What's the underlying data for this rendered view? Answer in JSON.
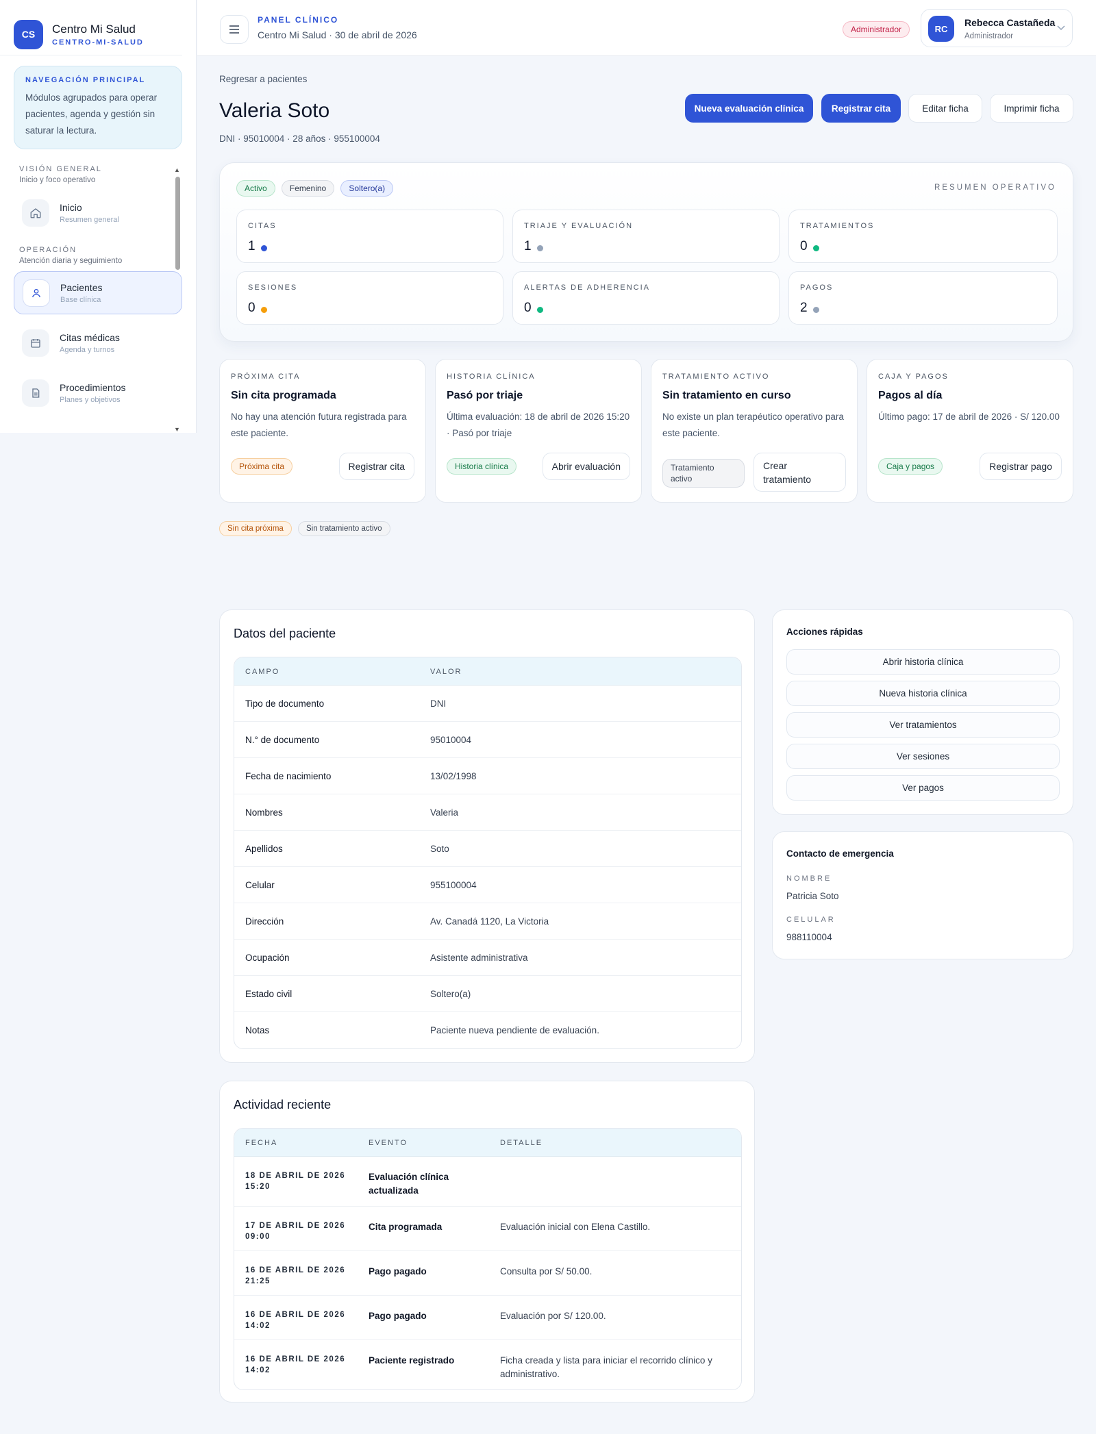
{
  "brand": {
    "logo": "CS",
    "name": "Centro Mi Salud",
    "slug": "CENTRO-MI-SALUD"
  },
  "nav_box": {
    "title": "NAVEGACIÓN PRINCIPAL",
    "text": "Módulos agrupados para operar pacientes, agenda y gestión sin saturar la lectura."
  },
  "sidebar": {
    "sections": [
      {
        "title": "VISIÓN GENERAL",
        "subtitle": "Inicio y foco operativo"
      },
      {
        "title": "OPERACIÓN",
        "subtitle": "Atención diaria y seguimiento"
      }
    ],
    "items": [
      {
        "label": "Inicio",
        "sub": "Resumen general",
        "icon": "home-icon"
      },
      {
        "label": "Pacientes",
        "sub": "Base clínica",
        "icon": "user-icon",
        "active": true
      },
      {
        "label": "Citas médicas",
        "sub": "Agenda y turnos",
        "icon": "calendar-icon"
      },
      {
        "label": "Procedimientos",
        "sub": "Planes y objetivos",
        "icon": "document-icon"
      }
    ]
  },
  "topbar": {
    "title": "PANEL CLÍNICO",
    "subtitle": "Centro Mi Salud · 30 de abril de 2026",
    "badge": "Administrador",
    "user": {
      "initials": "RC",
      "name": "Rebecca Castañeda",
      "role": "Administrador"
    }
  },
  "patient": {
    "back": "Regresar a pacientes",
    "name": "Valeria Soto",
    "meta": "DNI · 95010004 · 28 años · 955100004",
    "actions": [
      "Nueva evaluación clínica",
      "Registrar cita",
      "Editar ficha",
      "Imprimir ficha"
    ]
  },
  "summary": {
    "tags": [
      "Activo",
      "Femenino",
      "Soltero(a)"
    ],
    "heading": "RESUMEN OPERATIVO",
    "stats": [
      {
        "label": "CITAS",
        "value": "1",
        "color": "#2f54d6"
      },
      {
        "label": "TRIAJE Y EVALUACIÓN",
        "value": "1",
        "color": "#94a3b8"
      },
      {
        "label": "TRATAMIENTOS",
        "value": "0",
        "color": "#10b981"
      },
      {
        "label": "SESIONES",
        "value": "0",
        "color": "#f59e0b"
      },
      {
        "label": "ALERTAS DE ADHERENCIA",
        "value": "0",
        "color": "#10b981"
      },
      {
        "label": "PAGOS",
        "value": "2",
        "color": "#94a3b8"
      }
    ]
  },
  "cards": [
    {
      "label": "PRÓXIMA CITA",
      "title": "Sin cita programada",
      "text": "No hay una atención futura registrada para este paciente.",
      "tag": "Próxima cita",
      "button": "Registrar cita"
    },
    {
      "label": "HISTORIA CLÍNICA",
      "title": "Pasó por triaje",
      "text": "Última evaluación: 18 de abril de 2026 15:20 · Pasó por triaje",
      "tag": "Historia clínica",
      "button": "Abrir evaluación"
    },
    {
      "label": "TRATAMIENTO ACTIVO",
      "title": "Sin tratamiento en curso",
      "text": "No existe un plan terapéutico operativo para este paciente.",
      "tag": "Tratamiento activo",
      "button": "Crear tratamiento"
    },
    {
      "label": "CAJA Y PAGOS",
      "title": "Pagos al día",
      "text": "Último pago: 17 de abril de 2026 · S/ 120.00",
      "tag": "Caja y pagos",
      "button": "Registrar pago"
    }
  ],
  "status_tags": [
    "Sin cita próxima",
    "Sin tratamiento activo"
  ],
  "datos": {
    "title": "Datos del paciente",
    "headers": [
      "CAMPO",
      "VALOR"
    ],
    "rows": [
      [
        "Tipo de documento",
        "DNI"
      ],
      [
        "N.° de documento",
        "95010004"
      ],
      [
        "Fecha de nacimiento",
        "13/02/1998"
      ],
      [
        "Nombres",
        "Valeria"
      ],
      [
        "Apellidos",
        "Soto"
      ],
      [
        "Celular",
        "955100004"
      ],
      [
        "Dirección",
        "Av. Canadá 1120, La Victoria"
      ],
      [
        "Ocupación",
        "Asistente administrativa"
      ],
      [
        "Estado civil",
        "Soltero(a)"
      ],
      [
        "Notas",
        "Paciente nueva pendiente de evaluación."
      ]
    ]
  },
  "actividad": {
    "title": "Actividad reciente",
    "headers": [
      "FECHA",
      "EVENTO",
      "DETALLE"
    ],
    "rows": [
      {
        "fecha": "18 DE ABRIL DE 2026 15:20",
        "evento": "Evaluación clínica actualizada",
        "detalle": ""
      },
      {
        "fecha": "17 DE ABRIL DE 2026 09:00",
        "evento": "Cita programada",
        "detalle": "Evaluación inicial con Elena Castillo."
      },
      {
        "fecha": "16 DE ABRIL DE 2026 21:25",
        "evento": "Pago pagado",
        "detalle": "Consulta por S/ 50.00."
      },
      {
        "fecha": "16 DE ABRIL DE 2026 14:02",
        "evento": "Pago pagado",
        "detalle": "Evaluación por S/ 120.00."
      },
      {
        "fecha": "16 DE ABRIL DE 2026 14:02",
        "evento": "Paciente registrado",
        "detalle": "Ficha creada y lista para iniciar el recorrido clínico y administrativo."
      }
    ]
  },
  "acciones": {
    "title": "Acciones rápidas",
    "buttons": [
      "Abrir historia clínica",
      "Nueva historia clínica",
      "Ver tratamientos",
      "Ver sesiones",
      "Ver pagos"
    ]
  },
  "contacto": {
    "title": "Contacto de emergencia",
    "name_label": "NOMBRE",
    "name": "Patricia Soto",
    "phone_label": "CELULAR",
    "phone": "988110004"
  }
}
